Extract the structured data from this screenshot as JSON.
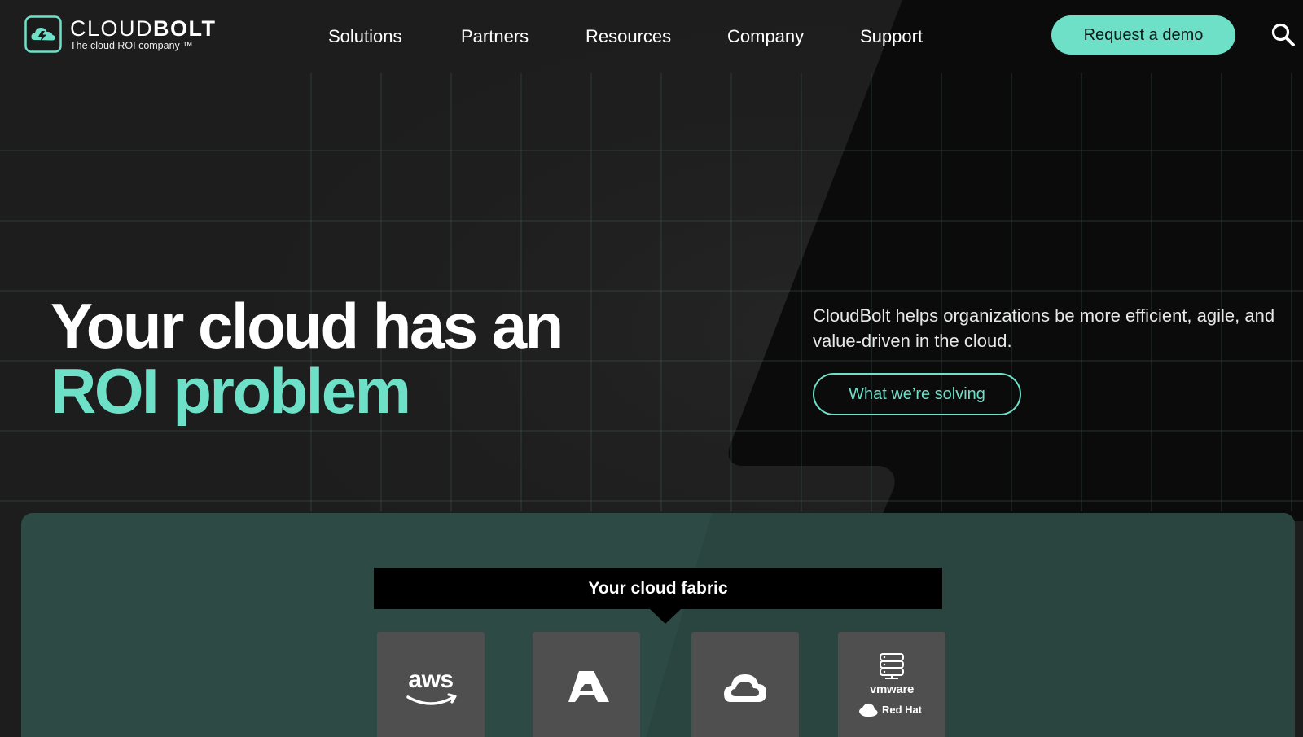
{
  "brand": {
    "name_light": "CLOUD",
    "name_bold": "BOLT",
    "tagline": "The cloud ROI company ™",
    "logo_icon": "cloud-bolt-logo-icon"
  },
  "nav": {
    "items": [
      {
        "label": "Solutions"
      },
      {
        "label": "Partners"
      },
      {
        "label": "Resources"
      },
      {
        "label": "Company"
      },
      {
        "label": "Support"
      }
    ],
    "demo_button": "Request a demo",
    "search_icon": "search-icon"
  },
  "hero": {
    "title_line1": "Your cloud has an",
    "title_line2": "ROI problem",
    "description": "CloudBolt helps organizations be more efficient, agile, and value-driven in the cloud.",
    "cta_label": "What we’re solving"
  },
  "fabric": {
    "title": "Your cloud fabric",
    "tiles": [
      {
        "name": "aws",
        "label": "aws",
        "icon": "aws-logo-icon"
      },
      {
        "name": "azure",
        "label": "",
        "icon": "azure-logo-icon"
      },
      {
        "name": "google-cloud",
        "label": "",
        "icon": "google-cloud-logo-icon"
      },
      {
        "name": "vmware-redhat",
        "label_top": "vmware",
        "label_bottom": "Red Hat",
        "icon": "server-stack-icon"
      }
    ]
  },
  "colors": {
    "accent": "#6ee0c8",
    "background": "#1c1c1c",
    "panel": "#2e4a44",
    "tile": "#4f4f4f"
  }
}
